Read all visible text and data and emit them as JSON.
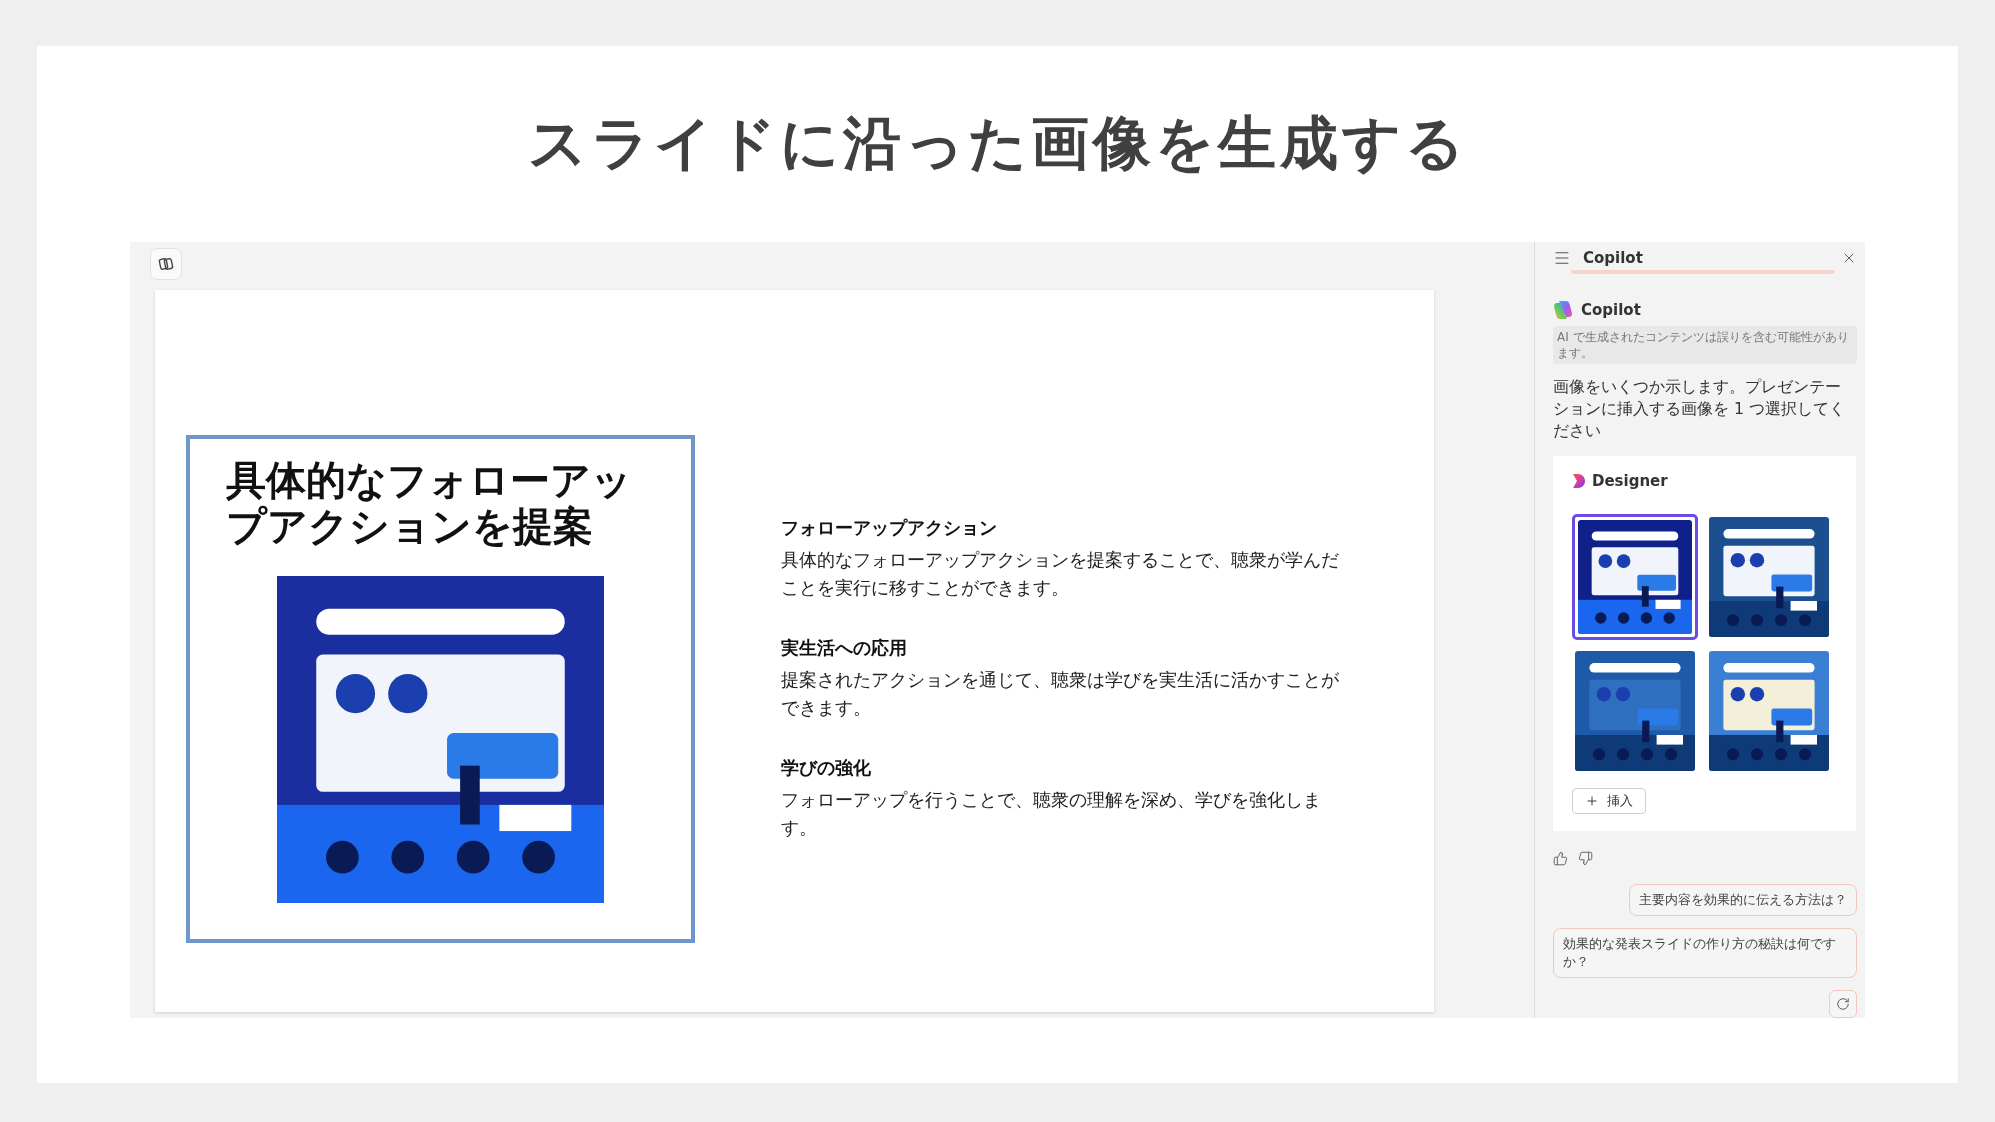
{
  "page_title": "スライドに沿った画像を生成する",
  "slide": {
    "image_title": "具体的なフォローアップアクションを提案",
    "image": {
      "kind": "picture"
    },
    "sections": [
      {
        "heading": "フォローアップアクション",
        "body": "具体的なフォローアップアクションを提案することで、聴衆が学んだことを実行に移すことができます。"
      },
      {
        "heading": "実生活への応用",
        "body": "提案されたアクションを通じて、聴衆は学びを実生活に活かすことができます。"
      },
      {
        "heading": "学びの強化",
        "body": "フォローアップを行うことで、聴衆の理解を深め、学びを強化します。"
      }
    ]
  },
  "copilot": {
    "header_title": "Copilot",
    "agent_name": "Copilot",
    "disclaimer": "AI で生成されたコンテンツは誤りを含む可能性があります。",
    "message": "画像をいくつか示します。プレゼンテーションに挿入する画像を 1 つ選択してください",
    "designer": {
      "label": "Designer",
      "images": [
        {
          "kind": "picture",
          "selected": true
        },
        {
          "kind": "picture",
          "selected": false
        },
        {
          "kind": "picture",
          "selected": false
        },
        {
          "kind": "picture",
          "selected": false
        }
      ],
      "insert_button": "挿入"
    },
    "suggestions": [
      "主要内容を効果的に伝える方法は？",
      "効果的な発表スライドの作り方の秘訣は何ですか？"
    ]
  }
}
